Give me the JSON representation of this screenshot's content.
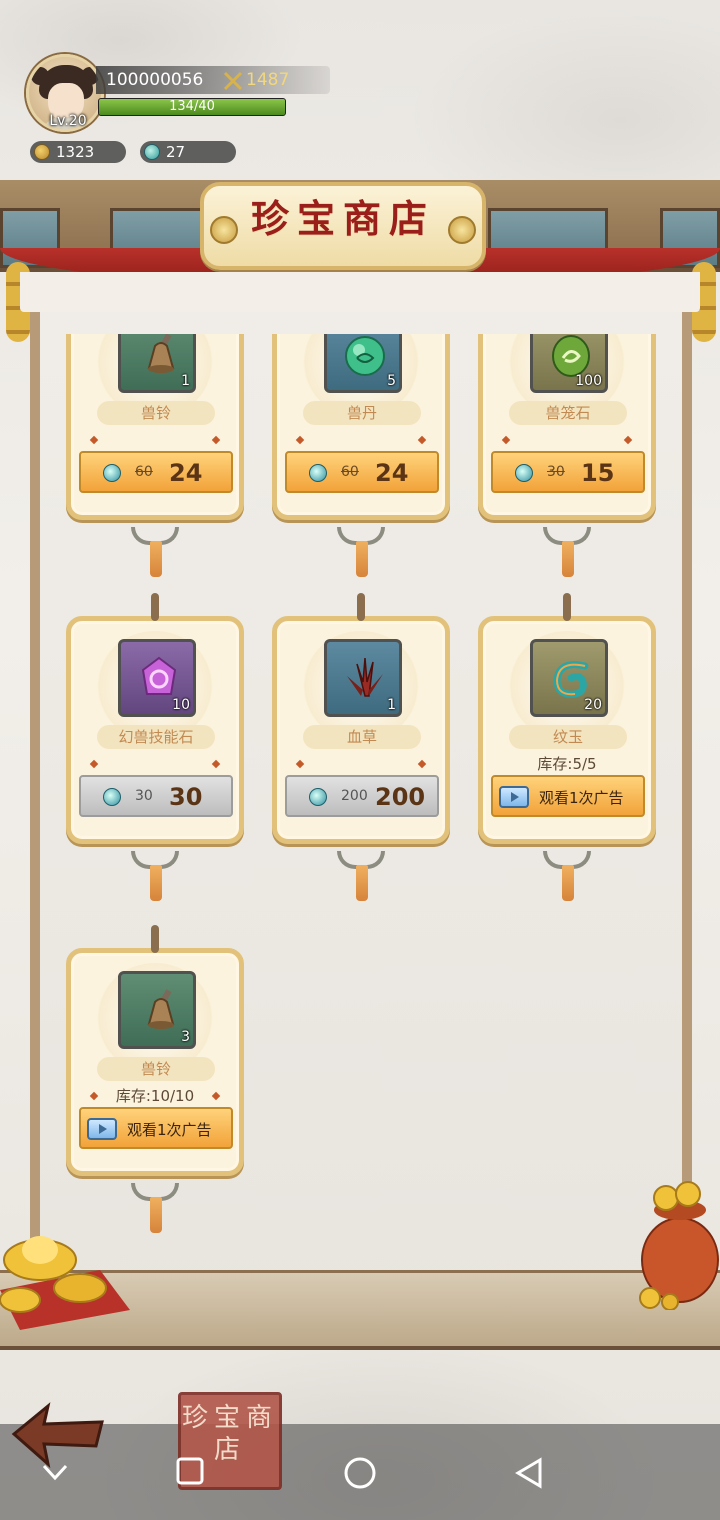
{
  "player": {
    "id": "100000056",
    "power": "1487",
    "level": "Lv.20",
    "exp_text": "134/40",
    "exp_fraction": 1.0
  },
  "currencies": {
    "coins": "1323",
    "jade": "27"
  },
  "shop": {
    "title": "珍宝商店",
    "seal_text": "珍宝商店"
  },
  "items": [
    {
      "name": "兽铃",
      "count": "1",
      "price_old": "60",
      "price_new": "24",
      "slot": "green",
      "art": "bell-icon",
      "type": "sale"
    },
    {
      "name": "兽丹",
      "count": "5",
      "price_old": "60",
      "price_new": "24",
      "slot": "blue",
      "art": "pill-icon",
      "type": "sale"
    },
    {
      "name": "兽笼石",
      "count": "100",
      "price_old": "30",
      "price_new": "15",
      "slot": "olive",
      "art": "stone-icon",
      "type": "sale"
    },
    {
      "name": "幻兽技能石",
      "count": "10",
      "price_old": "30",
      "price_new": "30",
      "slot": "purple",
      "art": "skill-stone-icon",
      "type": "grey"
    },
    {
      "name": "血草",
      "count": "1",
      "price_old": "200",
      "price_new": "200",
      "slot": "blue",
      "art": "blood-grass-icon",
      "type": "grey"
    },
    {
      "name": "纹玉",
      "count": "20",
      "stock": "库存:5/5",
      "ad_label": "观看1次广告",
      "slot": "olive",
      "art": "jade-swirl-icon",
      "type": "ad"
    },
    {
      "name": "兽铃",
      "count": "3",
      "stock": "库存:10/10",
      "ad_label": "观看1次广告",
      "slot": "green",
      "art": "bell-icon",
      "type": "ad"
    }
  ],
  "colors": {
    "title_red": "#9a1e1a",
    "button_orange": "#f2a33a",
    "button_grey": "#bdbdbd"
  }
}
